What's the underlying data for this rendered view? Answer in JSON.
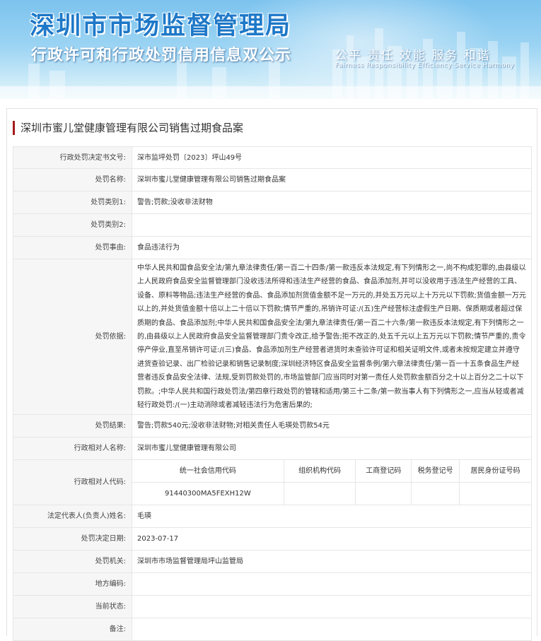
{
  "banner": {
    "title": "深圳市市场监督管理局",
    "subtitle": "行政许可和行政处罚信用信息双公示",
    "slogan": "公平 责任 效能 服务 和谐",
    "slogan_en": "Fairness Responsibility Efficiency Service Harmony"
  },
  "case_title": "深圳市蜜儿堂健康管理有限公司销售过期食品案",
  "rows": {
    "decision_no": {
      "label": "行政处罚决定书文号:",
      "value": "深市监坪处罚〔2023〕坪山49号"
    },
    "case_name": {
      "label": "处罚名称:",
      "value": "深圳市蜜儿堂健康管理有限公司销售过期食品案"
    },
    "category1": {
      "label": "处罚类别1:",
      "value": "警告;罚款;没收非法财物"
    },
    "category2": {
      "label": "处罚类别2:",
      "value": ""
    },
    "reason": {
      "label": "处罚事由:",
      "value": "食品违法行为"
    },
    "basis": {
      "label": "处罚依据:",
      "value": "中华人民共和国食品安全法/第九章法律责任/第一百二十四条/第一款违反本法规定,有下列情形之一,尚不构成犯罪的,由县级以上人民政府食品安全监督管理部门没收违法所得和违法生产经营的食品、食品添加剂,并可以没收用于违法生产经营的工具、设备、原料等物品;违法生产经营的食品、食品添加剂货值金额不足一万元的,并处五万元以上十万元以下罚款;货值金额一万元以上的,并处货值金额十倍以上二十倍以下罚款;情节严重的,吊销许可证:/(五)生产经营标注虚假生产日期、保质期或者超过保质期的食品、食品添加剂;中华人民共和国食品安全法/第九章法律责任/第一百二十六条/第一款违反本法规定,有下列情形之一的,由县级以上人民政府食品安全监督管理部门责令改正,给予警告;拒不改正的,处五千元以上五万元以下罚款;情节严重的,责令停产停业,直至吊销许可证:/(三)食品、食品添加剂生产经营者进货时未查验许可证和相关证明文件,或者未按规定建立并遵守进货查验记录、出厂检验记录和销售记录制度;深圳经济特区食品安全监督条例/第六章法律责任/第一百一十五条食品生产经营者违反食品安全法律、法规,受到罚款处罚的,市场监管部门应当同时对第一责任人处罚款金额百分之十以上百分之二十以下罚款。;中华人民共和国行政处罚法/第四章行政处罚的管辖和适用/第三十二条/第一款当事人有下列情形之一,应当从轻或者减轻行政处罚:/(一)主动消除或者减轻违法行为危害后果的;"
    },
    "result": {
      "label": "处罚结果:",
      "value": "警告;罚款540元;没收非法财物;对相关责任人毛瑛处罚款54元"
    },
    "party_name": {
      "label": "行政相对人名称:",
      "value": "深圳市蜜儿堂健康管理有限公司"
    },
    "party_codes": {
      "label": "行政相对人代码:",
      "headers": [
        "统一社会信用代码",
        "组织机构代码",
        "工商登记码",
        "税务登记号",
        "居民身份证号码"
      ],
      "values": [
        "91440300MA5FEXH12W",
        "",
        "",
        "",
        ""
      ]
    },
    "legal_rep": {
      "label": "法定代表人(负责人)姓名:",
      "value": "毛瑛"
    },
    "decision_date": {
      "label": "处罚决定日期:",
      "value": "2023-07-17"
    },
    "authority": {
      "label": "处罚机关:",
      "value": "深圳市市场监督管理局坪山监管局"
    },
    "area_code": {
      "label": "地方编码:",
      "value": ""
    },
    "status": {
      "label": "当前状态:",
      "value": ""
    },
    "remarks": {
      "label": "备注:",
      "value": ""
    }
  },
  "colors": {
    "banner_title": "#1e78c8",
    "title_accent": "#a31c1c",
    "label_bg": "#f6f6f6",
    "border": "#e6e6e6"
  }
}
